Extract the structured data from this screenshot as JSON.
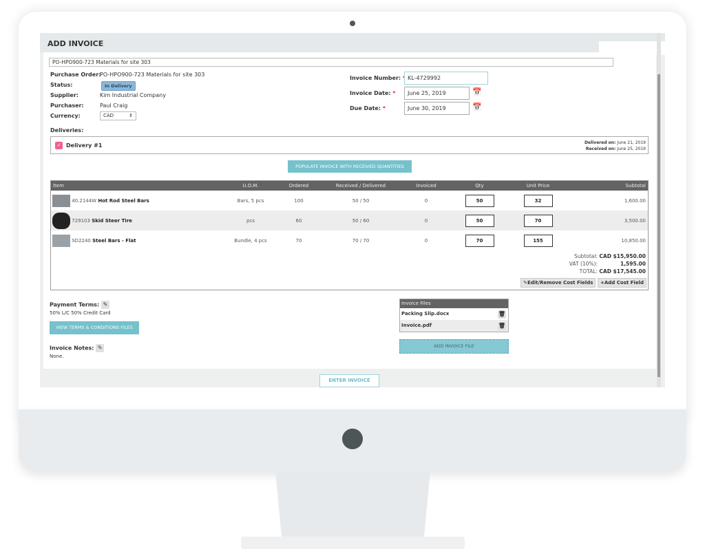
{
  "header": {
    "title": "ADD INVOICE"
  },
  "po_select": "PO-HPO900-723 Materials for site 303",
  "details": {
    "purchase_order_label": "Purchase Order:",
    "purchase_order": "PO-HPO900-723 Materials for site 303",
    "status_label": "Status:",
    "status": "In Delivery",
    "supplier_label": "Supplier:",
    "supplier": "Kim Industrial Company",
    "purchaser_label": "Purchaser:",
    "purchaser": "Paul Craig",
    "currency_label": "Currency:",
    "currency": "CAD"
  },
  "invoice": {
    "number_label": "Invoice Number:",
    "number": "KL-4729992",
    "date_label": "Invoice Date:",
    "date": "June 25, 2019",
    "due_label": "Due Date:",
    "due": "June 30, 2019",
    "required": "*"
  },
  "deliveries": {
    "label": "Deliveries:",
    "name": "Delivery #1",
    "delivered_label": "Delivered on:",
    "delivered": "June 21, 2019",
    "received_label": "Received on:",
    "received": "June 25, 2019",
    "checked": true
  },
  "populate_button": "POPULATE INVOICE WITH RECEIVED QUANTITIES",
  "table": {
    "headers": [
      "Item",
      "U.O.M.",
      "Ordered",
      "Received / Delivered",
      "Invoiced",
      "Qty",
      "Unit Price",
      "Subtotal"
    ],
    "rows": [
      {
        "code": "40.2144W",
        "name": "Hot Rod Steel Bars",
        "uom": "Bars, 5 pcs",
        "ordered": "100",
        "received": "50 / 50",
        "invoiced": "0",
        "qty": "50",
        "price": "32",
        "subtotal": "1,600.00"
      },
      {
        "code": "729103",
        "name": "Skid Steer Tire",
        "uom": "pcs",
        "ordered": "60",
        "received": "50 / 60",
        "invoiced": "0",
        "qty": "50",
        "price": "70",
        "subtotal": "3,500.00"
      },
      {
        "code": "SD2240",
        "name": "Steel Bars - Flat",
        "uom": "Bundle, 4 pcs",
        "ordered": "70",
        "received": "70 / 70",
        "invoiced": "0",
        "qty": "70",
        "price": "155",
        "subtotal": "10,850.00"
      }
    ]
  },
  "totals": {
    "subtotal_label": "Subtotal:",
    "subtotal": "CAD $15,950.00",
    "vat_label": "VAT (10%):",
    "vat": "1,595.00",
    "total_label": "TOTAL:",
    "total": "CAD $17,545.00",
    "edit_button": "Edit/Remove Cost Fields",
    "add_button": "Add Cost Field"
  },
  "payment": {
    "label": "Payment Terms:",
    "value": "50% L/C 50% Credit Card",
    "view_button": "VIEW TERMS & CONDITIONS FILES"
  },
  "notes": {
    "label": "Invoice Notes:",
    "value": "None."
  },
  "files": {
    "header": "Invoice Files",
    "items": [
      "Packing Slip.docx",
      "Invoice.pdf"
    ],
    "add_button": "ADD INVOICE FILE"
  },
  "enter_button": "ENTER INVOICE",
  "colors": {
    "accent": "#75c1cc",
    "table_header": "#636363",
    "checkbox": "#f06292",
    "badge": "#8bb7d8"
  }
}
